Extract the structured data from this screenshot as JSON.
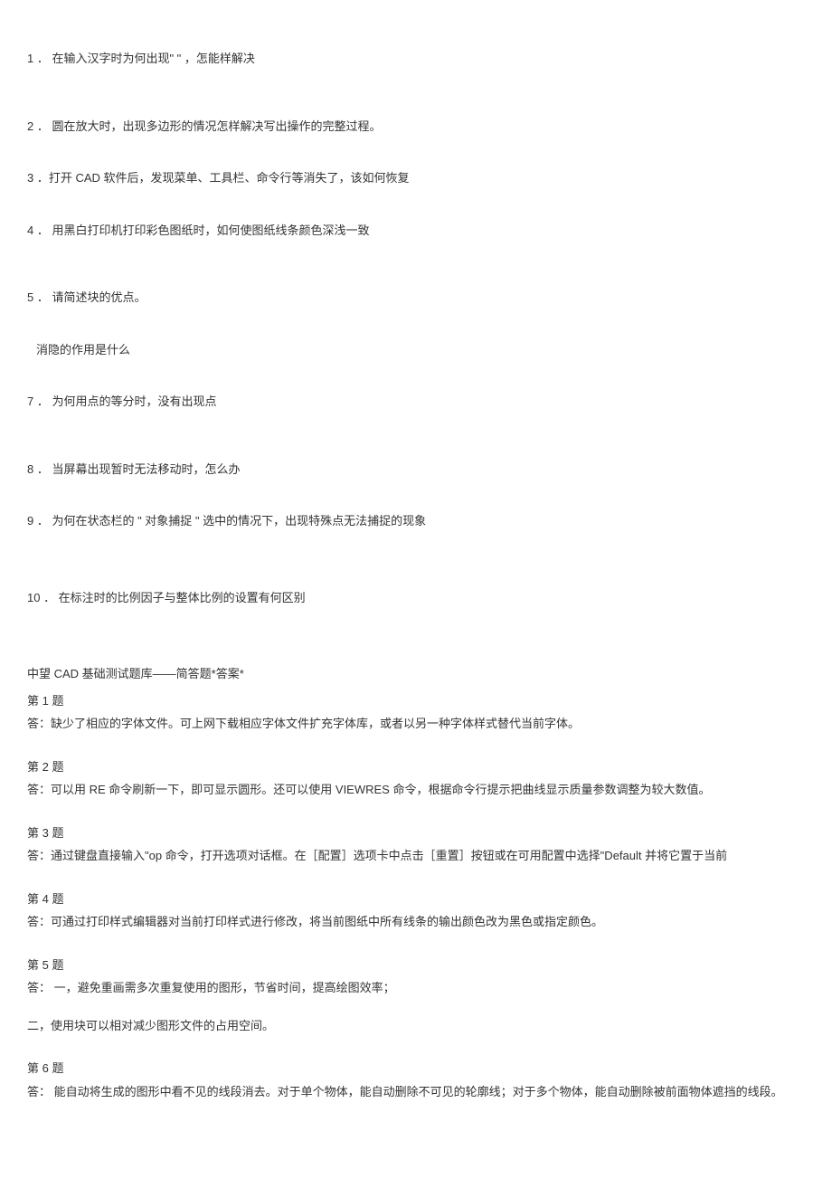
{
  "questions": {
    "q1": "1 ． 在输入汉字时为何出现\" \" ，怎能样解决",
    "q2": "2 ． 圆在放大时，出现多边形的情况怎样解决写出操作的完整过程。",
    "q3": "3 ．打开 CAD 软件后，发现菜单、工具栏、命令行等消失了，该如何恢复",
    "q4": "4 ． 用黑白打印机打印彩色图纸时，如何使图纸线条颜色深浅一致",
    "q5": "5 ． 请简述块的优点。",
    "q6_sub": "消隐的作用是什么",
    "q7": "7 ． 为何用点的等分时，没有出现点",
    "q8": "8 ． 当屏幕出现暂时无法移动时，怎么办",
    "q9": "9 ． 为何在状态栏的 \" 对象捕捉 \" 选中的情况下，出现特殊点无法捕捉的现象",
    "q10": "10 ． 在标注时的比例因子与整体比例的设置有何区别"
  },
  "answers_title": "中望 CAD 基础测试题库——简答题*答案*",
  "answers": {
    "a1_num": "第 1 题",
    "a1_text": "答：缺少了相应的字体文件。可上网下载相应字体文件扩充字体库，或者以另一种字体样式替代当前字体。",
    "a2_num": "第 2 题",
    "a2_text": "答：可以用 RE 命令刷新一下，即可显示圆形。还可以使用 VIEWRES 命令，根据命令行提示把曲线显示质量参数调整为较大数值。",
    "a3_num": "第 3 题",
    "a3_text": "答：通过键盘直接输入\"op 命令，打开选项对话框。在［配置］选项卡中点击［重置］按钮或在可用配置中选择\"Default 并将它置于当前",
    "a4_num": "第 4 题",
    "a4_text": "答：可通过打印样式编辑器对当前打印样式进行修改，将当前图纸中所有线条的输出颜色改为黑色或指定颜色。",
    "a5_num": "第 5 题",
    "a5_text1": "答： 一，避免重画需多次重复使用的图形，节省时间，提高绘图效率；",
    "a5_text2": "二，使用块可以相对减少图形文件的占用空间。",
    "a6_num": "第 6 题",
    "a6_text": "答： 能自动将生成的图形中看不见的线段消去。对于单个物体，能自动删除不可见的轮廓线；对于多个物体，能自动删除被前面物体遮挡的线段。"
  }
}
